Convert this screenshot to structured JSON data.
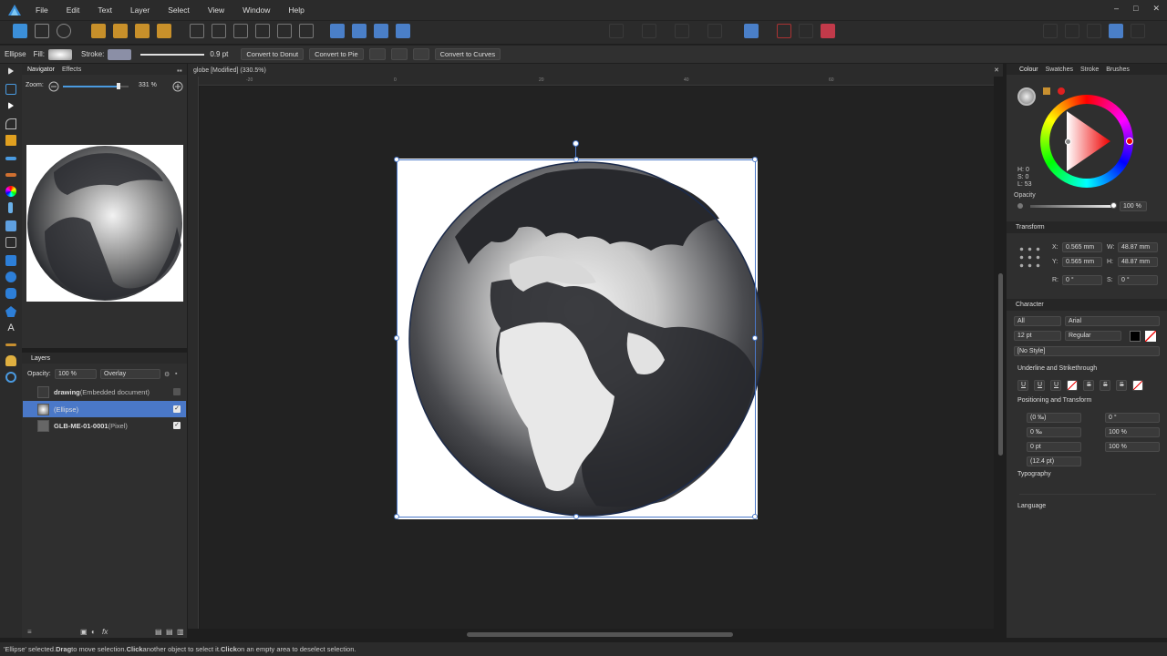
{
  "menu": [
    "File",
    "Edit",
    "Text",
    "Layer",
    "Select",
    "View",
    "Window",
    "Help"
  ],
  "window_controls": [
    "–",
    "□",
    "✕"
  ],
  "context": {
    "shape": "Ellipse",
    "fill_label": "Fill:",
    "stroke_label": "Stroke:",
    "stroke_width": "0.9 pt",
    "btn_donut": "Convert to Donut",
    "btn_pie": "Convert to Pie",
    "btn_curves": "Convert to Curves"
  },
  "navigator": {
    "tabs": [
      "Navigator",
      "Effects"
    ],
    "zoom_label": "Zoom:",
    "zoom_value": "331 %",
    "zoom_fraction": 0.85
  },
  "layers": {
    "title": "Layers",
    "opacity_label": "Opacity:",
    "opacity_value": "100 %",
    "blend_mode": "Overlay",
    "items": [
      {
        "name": "drawing",
        "detail": " (Embedded document)",
        "checked": false
      },
      {
        "name": "(Ellipse)",
        "detail": "",
        "checked": true
      },
      {
        "name": "GLB-ME-01-0001",
        "detail": " (Pixel)",
        "checked": true
      }
    ]
  },
  "document": {
    "tab_title": "globe [Modified] (330.5%)",
    "ruler_labels": [
      "-20",
      "0",
      "20",
      "40",
      "60"
    ]
  },
  "colour": {
    "tabs": [
      "Colour",
      "Swatches",
      "Stroke",
      "Brushes"
    ],
    "h": "H: 0",
    "s": "S: 0",
    "l": "L: 53",
    "opacity_label": "Opacity",
    "opacity_value": "100 %",
    "opacity_fraction": 1.0
  },
  "transform": {
    "title": "Transform",
    "x": "0.565 mm",
    "y": "0.565 mm",
    "w": "48.87 mm",
    "h": "48.87 mm",
    "r": "0 °",
    "s": "0 °"
  },
  "character": {
    "title": "Character",
    "scope": "All",
    "font": "Arial",
    "size": "12 pt",
    "weight": "Regular",
    "style": "[No Style]",
    "underline_section": "Underline and Strikethrough",
    "positioning_section": "Positioning and Transform",
    "tracking": "(0 ‰)",
    "italic_angle": "0 °",
    "kerning": "0 ‰",
    "h_scale": "100 %",
    "baseline": "0 pt",
    "v_scale": "100 %",
    "leading": "(12.4 pt)",
    "typography_section": "Typography",
    "language_section": "Language"
  },
  "status": {
    "parts": [
      {
        "t": "'Ellipse' selected. ",
        "b": false
      },
      {
        "t": "Drag",
        "b": true
      },
      {
        "t": " to move selection. ",
        "b": false
      },
      {
        "t": "Click",
        "b": true
      },
      {
        "t": " another object to select it. ",
        "b": false
      },
      {
        "t": "Click",
        "b": true
      },
      {
        "t": " on an empty area to deselect selection.",
        "b": false
      }
    ]
  }
}
